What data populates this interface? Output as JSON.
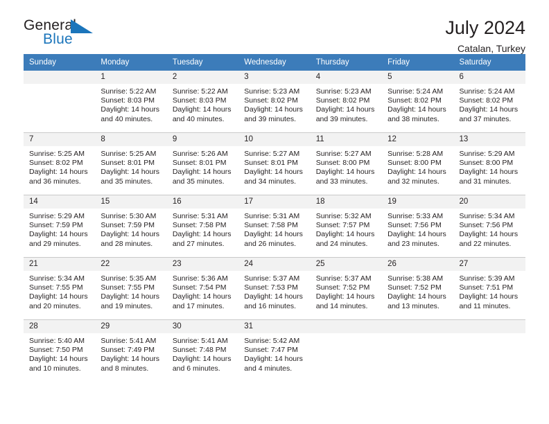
{
  "brand": {
    "name_top": "General",
    "name_bottom": "Blue",
    "mark": "blue-triangle-flag-icon",
    "color_text": "#231f20",
    "color_blue": "#1b75bb"
  },
  "header": {
    "title": "July 2024",
    "location": "Catalan, Turkey"
  },
  "theme": {
    "header_row_bg": "#3c7cba",
    "header_row_text": "#ffffff",
    "daynum_bg": "#f2f2f2",
    "row_divider": "#3c7cba",
    "cell_border": "#c9c9c9"
  },
  "weekday_headers": [
    "Sunday",
    "Monday",
    "Tuesday",
    "Wednesday",
    "Thursday",
    "Friday",
    "Saturday"
  ],
  "labels": {
    "sunrise_prefix": "Sunrise:",
    "sunset_prefix": "Sunset:",
    "daylight_prefix": "Daylight:"
  },
  "weeks": [
    [
      {
        "day": "",
        "empty": true
      },
      {
        "day": "1",
        "sunrise": "Sunrise: 5:22 AM",
        "sunset": "Sunset: 8:03 PM",
        "daylight_l1": "Daylight: 14 hours",
        "daylight_l2": "and 40 minutes."
      },
      {
        "day": "2",
        "sunrise": "Sunrise: 5:22 AM",
        "sunset": "Sunset: 8:03 PM",
        "daylight_l1": "Daylight: 14 hours",
        "daylight_l2": "and 40 minutes."
      },
      {
        "day": "3",
        "sunrise": "Sunrise: 5:23 AM",
        "sunset": "Sunset: 8:02 PM",
        "daylight_l1": "Daylight: 14 hours",
        "daylight_l2": "and 39 minutes."
      },
      {
        "day": "4",
        "sunrise": "Sunrise: 5:23 AM",
        "sunset": "Sunset: 8:02 PM",
        "daylight_l1": "Daylight: 14 hours",
        "daylight_l2": "and 39 minutes."
      },
      {
        "day": "5",
        "sunrise": "Sunrise: 5:24 AM",
        "sunset": "Sunset: 8:02 PM",
        "daylight_l1": "Daylight: 14 hours",
        "daylight_l2": "and 38 minutes."
      },
      {
        "day": "6",
        "sunrise": "Sunrise: 5:24 AM",
        "sunset": "Sunset: 8:02 PM",
        "daylight_l1": "Daylight: 14 hours",
        "daylight_l2": "and 37 minutes."
      }
    ],
    [
      {
        "day": "7",
        "sunrise": "Sunrise: 5:25 AM",
        "sunset": "Sunset: 8:02 PM",
        "daylight_l1": "Daylight: 14 hours",
        "daylight_l2": "and 36 minutes."
      },
      {
        "day": "8",
        "sunrise": "Sunrise: 5:25 AM",
        "sunset": "Sunset: 8:01 PM",
        "daylight_l1": "Daylight: 14 hours",
        "daylight_l2": "and 35 minutes."
      },
      {
        "day": "9",
        "sunrise": "Sunrise: 5:26 AM",
        "sunset": "Sunset: 8:01 PM",
        "daylight_l1": "Daylight: 14 hours",
        "daylight_l2": "and 35 minutes."
      },
      {
        "day": "10",
        "sunrise": "Sunrise: 5:27 AM",
        "sunset": "Sunset: 8:01 PM",
        "daylight_l1": "Daylight: 14 hours",
        "daylight_l2": "and 34 minutes."
      },
      {
        "day": "11",
        "sunrise": "Sunrise: 5:27 AM",
        "sunset": "Sunset: 8:00 PM",
        "daylight_l1": "Daylight: 14 hours",
        "daylight_l2": "and 33 minutes."
      },
      {
        "day": "12",
        "sunrise": "Sunrise: 5:28 AM",
        "sunset": "Sunset: 8:00 PM",
        "daylight_l1": "Daylight: 14 hours",
        "daylight_l2": "and 32 minutes."
      },
      {
        "day": "13",
        "sunrise": "Sunrise: 5:29 AM",
        "sunset": "Sunset: 8:00 PM",
        "daylight_l1": "Daylight: 14 hours",
        "daylight_l2": "and 31 minutes."
      }
    ],
    [
      {
        "day": "14",
        "sunrise": "Sunrise: 5:29 AM",
        "sunset": "Sunset: 7:59 PM",
        "daylight_l1": "Daylight: 14 hours",
        "daylight_l2": "and 29 minutes."
      },
      {
        "day": "15",
        "sunrise": "Sunrise: 5:30 AM",
        "sunset": "Sunset: 7:59 PM",
        "daylight_l1": "Daylight: 14 hours",
        "daylight_l2": "and 28 minutes."
      },
      {
        "day": "16",
        "sunrise": "Sunrise: 5:31 AM",
        "sunset": "Sunset: 7:58 PM",
        "daylight_l1": "Daylight: 14 hours",
        "daylight_l2": "and 27 minutes."
      },
      {
        "day": "17",
        "sunrise": "Sunrise: 5:31 AM",
        "sunset": "Sunset: 7:58 PM",
        "daylight_l1": "Daylight: 14 hours",
        "daylight_l2": "and 26 minutes."
      },
      {
        "day": "18",
        "sunrise": "Sunrise: 5:32 AM",
        "sunset": "Sunset: 7:57 PM",
        "daylight_l1": "Daylight: 14 hours",
        "daylight_l2": "and 24 minutes."
      },
      {
        "day": "19",
        "sunrise": "Sunrise: 5:33 AM",
        "sunset": "Sunset: 7:56 PM",
        "daylight_l1": "Daylight: 14 hours",
        "daylight_l2": "and 23 minutes."
      },
      {
        "day": "20",
        "sunrise": "Sunrise: 5:34 AM",
        "sunset": "Sunset: 7:56 PM",
        "daylight_l1": "Daylight: 14 hours",
        "daylight_l2": "and 22 minutes."
      }
    ],
    [
      {
        "day": "21",
        "sunrise": "Sunrise: 5:34 AM",
        "sunset": "Sunset: 7:55 PM",
        "daylight_l1": "Daylight: 14 hours",
        "daylight_l2": "and 20 minutes."
      },
      {
        "day": "22",
        "sunrise": "Sunrise: 5:35 AM",
        "sunset": "Sunset: 7:55 PM",
        "daylight_l1": "Daylight: 14 hours",
        "daylight_l2": "and 19 minutes."
      },
      {
        "day": "23",
        "sunrise": "Sunrise: 5:36 AM",
        "sunset": "Sunset: 7:54 PM",
        "daylight_l1": "Daylight: 14 hours",
        "daylight_l2": "and 17 minutes."
      },
      {
        "day": "24",
        "sunrise": "Sunrise: 5:37 AM",
        "sunset": "Sunset: 7:53 PM",
        "daylight_l1": "Daylight: 14 hours",
        "daylight_l2": "and 16 minutes."
      },
      {
        "day": "25",
        "sunrise": "Sunrise: 5:37 AM",
        "sunset": "Sunset: 7:52 PM",
        "daylight_l1": "Daylight: 14 hours",
        "daylight_l2": "and 14 minutes."
      },
      {
        "day": "26",
        "sunrise": "Sunrise: 5:38 AM",
        "sunset": "Sunset: 7:52 PM",
        "daylight_l1": "Daylight: 14 hours",
        "daylight_l2": "and 13 minutes."
      },
      {
        "day": "27",
        "sunrise": "Sunrise: 5:39 AM",
        "sunset": "Sunset: 7:51 PM",
        "daylight_l1": "Daylight: 14 hours",
        "daylight_l2": "and 11 minutes."
      }
    ],
    [
      {
        "day": "28",
        "sunrise": "Sunrise: 5:40 AM",
        "sunset": "Sunset: 7:50 PM",
        "daylight_l1": "Daylight: 14 hours",
        "daylight_l2": "and 10 minutes."
      },
      {
        "day": "29",
        "sunrise": "Sunrise: 5:41 AM",
        "sunset": "Sunset: 7:49 PM",
        "daylight_l1": "Daylight: 14 hours",
        "daylight_l2": "and 8 minutes."
      },
      {
        "day": "30",
        "sunrise": "Sunrise: 5:41 AM",
        "sunset": "Sunset: 7:48 PM",
        "daylight_l1": "Daylight: 14 hours",
        "daylight_l2": "and 6 minutes."
      },
      {
        "day": "31",
        "sunrise": "Sunrise: 5:42 AM",
        "sunset": "Sunset: 7:47 PM",
        "daylight_l1": "Daylight: 14 hours",
        "daylight_l2": "and 4 minutes."
      },
      {
        "day": "",
        "empty": true
      },
      {
        "day": "",
        "empty": true
      },
      {
        "day": "",
        "empty": true
      }
    ]
  ]
}
